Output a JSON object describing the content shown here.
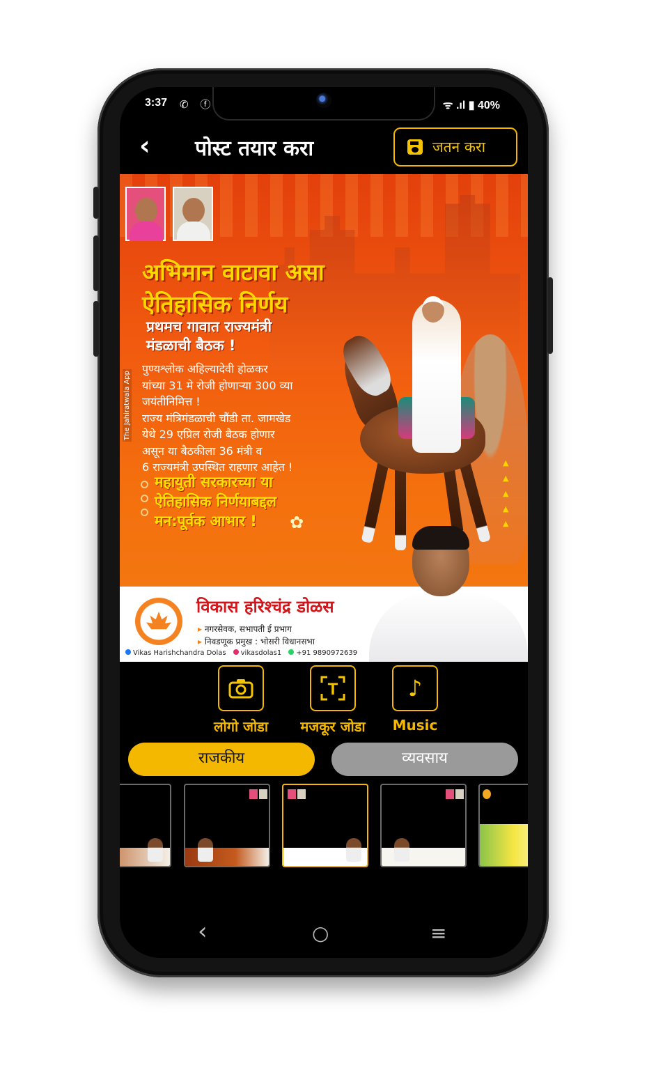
{
  "status": {
    "time": "3:37",
    "left_icons": "✆ ⓕ",
    "right": "ᯤ .ıl ▮ 40%"
  },
  "header": {
    "back_icon": "‹",
    "title": "पोस्ट तयार करा",
    "save_label": "जतन करा"
  },
  "poster": {
    "headline": [
      "अभिमान वाटावा असा",
      "ऐतिहासिक निर्णय"
    ],
    "subheadline": [
      "प्रथमच गावात राज्यमंत्री",
      "मंडळाची बैठक !"
    ],
    "body": [
      "पुण्यश्लोक अहिल्यादेवी होळकर",
      "यांच्या 31 मे रोजी होणाऱ्या 300 व्या",
      "जयंतीनिमित्त !",
      "राज्य मंत्रिमंडळाची चौंडी ता. जामखेड",
      "येथे 29 एप्रिल रोजी बैठक होणार",
      "असून या बैठकीला 36 मंत्री व",
      "6 राज्यमंत्री उपस्थित राहणार आहेत !"
    ],
    "thanks": [
      "महायुती सरकारच्या या",
      "ऐतिहासिक निर्णयाबद्दल",
      "मन:पूर्वक आभार !"
    ],
    "app_watermark": "The Jahiratwala App",
    "footer_name": "विकास हरिश्चंद्र डोळस",
    "footer_roles": [
      "नगरसेवक, सभापती ई प्रभाग",
      "निवडणूक प्रमुख : भोसरी विधानसभा"
    ],
    "social": {
      "facebook": "Vikas Harishchandra Dolas",
      "instagram": "vikasdolas1",
      "phone": "+91 9890972639"
    },
    "colors": {
      "orange": "#f15a0f",
      "yellow": "#ffd800",
      "red_name": "#d2151b"
    }
  },
  "tools": {
    "logo_label": "लोगो जोडा",
    "text_label": "मजकूर जोडा",
    "music_label": "Music",
    "logo_icon": "camera-icon",
    "text_icon": "text-frame-icon",
    "music_icon": "music-note-icon"
  },
  "tabs": {
    "active": "राजकीय",
    "inactive": "व्यवसाय"
  },
  "nav": {
    "back": "‹",
    "home": "○",
    "recents": "≡"
  },
  "accent_color": "#f5b800"
}
